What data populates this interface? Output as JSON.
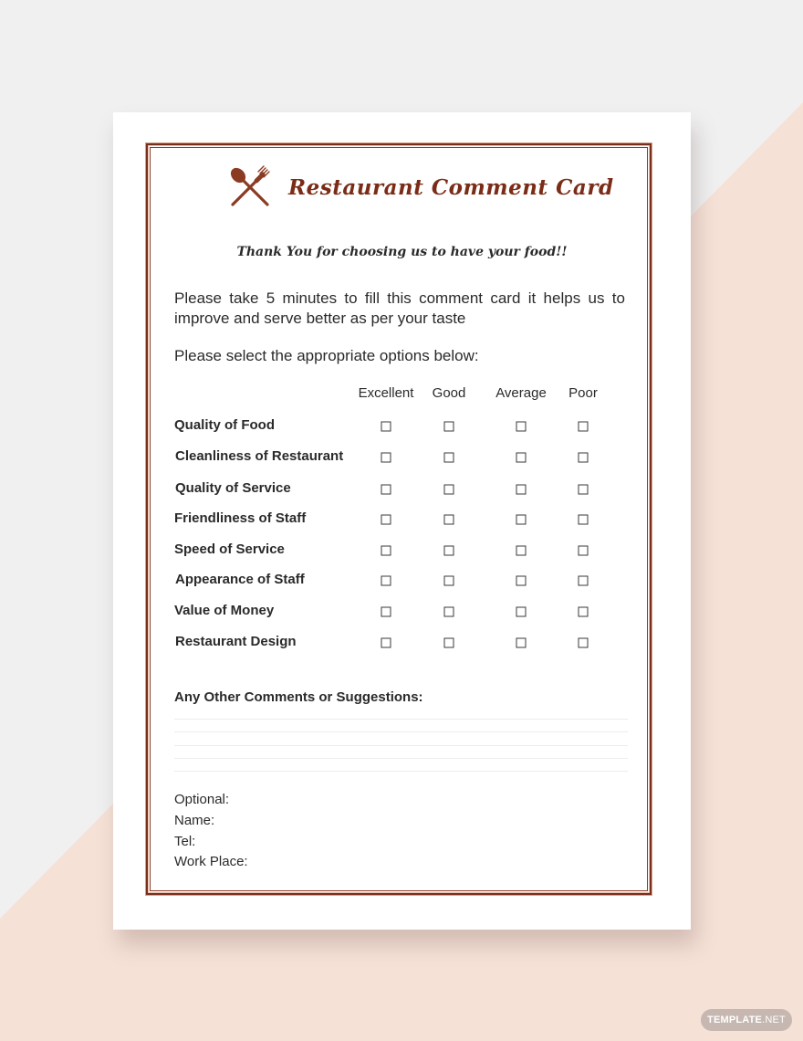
{
  "colors": {
    "background_light": "#f0f0f1",
    "background_peach": "#f6e1d7",
    "paper": "#ffffff",
    "frame": "#7a2f1d",
    "title": "#7b2c17",
    "icon": "#8b3b22",
    "text": "#2a2a2a"
  },
  "card": {
    "icon": "cutlery-icon",
    "title": "Restaurant Comment Card",
    "thanks": "Thank You for choosing us to have your food!!",
    "intro_line1": "Please take 5 minutes to fill this comment card it helps us to",
    "intro_line2": "improve and serve better as per your taste",
    "select_prompt": "Please select the appropriate options below:",
    "columns": [
      "Excellent",
      "Good",
      "Average",
      "Poor"
    ],
    "rows": [
      "Quality of Food",
      "Cleanliness of Restaurant",
      "Quality of Service",
      "Friendliness of Staff",
      "Speed of Service",
      "Appearance of Staff",
      "Value of Money",
      "Restaurant Design"
    ],
    "checkbox_glyph": "☐",
    "comments_label": "Any Other Comments or Suggestions:",
    "optional": {
      "heading": "Optional:",
      "name": "Name:",
      "tel": "Tel:",
      "work_place": "Work Place:"
    }
  },
  "watermark": {
    "brand": "TEMPLATE",
    "suffix": ".NET"
  }
}
